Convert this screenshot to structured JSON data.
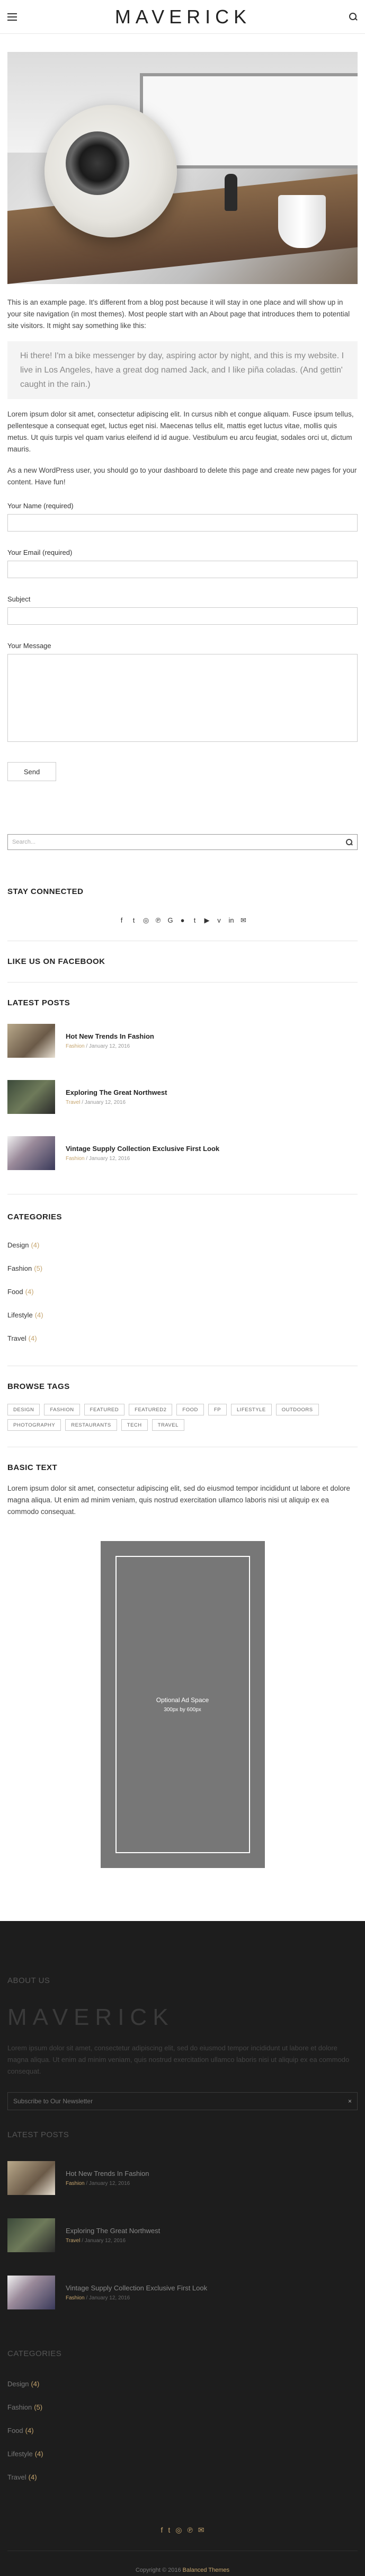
{
  "header": {
    "logo": "MAVERICK",
    "menu_icon": "hamburger-icon",
    "search_icon": "search-icon"
  },
  "hero_image": {
    "alt": ""
  },
  "page": {
    "p1": "This is an example page. It's different from a blog post because it will stay in one place and will show up in your site navigation (in most themes). Most people start with an About page that introduces them to potential site visitors. It might say something like this:",
    "quote": "Hi there! I'm a bike messenger by day, aspiring actor by night, and this is my website. I live in Los Angeles, have a great dog named Jack, and I like piña coladas. (And gettin' caught in the rain.)",
    "p2": "Lorem ipsum dolor sit amet, consectetur adipiscing elit. In cursus nibh et congue aliquam. Fusce ipsum tellus, pellentesque a consequat eget, luctus eget nisi. Maecenas tellus elit, mattis eget luctus vitae, mollis quis metus. Ut quis turpis vel quam varius eleifend id id augue. Vestibulum eu arcu feugiat, sodales orci ut, dictum mauris.",
    "p3": "As a new WordPress user, you should go to your dashboard to delete this page and create new pages for your content. Have fun!"
  },
  "form": {
    "name_label": "Your Name (required)",
    "email_label": "Your Email (required)",
    "subject_label": "Subject",
    "message_label": "Your Message",
    "send_label": "Send"
  },
  "sidebar": {
    "search_placeholder": "Search...",
    "stay_connected": "STAY CONNECTED",
    "social_icons": [
      "facebook-icon",
      "twitter-icon",
      "instagram-icon",
      "pinterest-icon",
      "google-plus-icon",
      "flickr-icon",
      "tumblr-icon",
      "youtube-icon",
      "vimeo-icon",
      "linkedin-icon",
      "email-icon"
    ],
    "facebook_title": "LIKE US ON FACEBOOK",
    "latest_posts_title": "LATEST POSTS",
    "posts": [
      {
        "title": "Hot New Trends In Fashion",
        "category": "Fashion",
        "date": "January 12, 2016"
      },
      {
        "title": "Exploring The Great Northwest",
        "category": "Travel",
        "date": "January 12, 2016"
      },
      {
        "title": "Vintage Supply Collection Exclusive First Look",
        "category": "Fashion",
        "date": "January 12, 2016"
      }
    ],
    "categories_title": "CATEGORIES",
    "categories": [
      {
        "name": "Design",
        "count": "(4)"
      },
      {
        "name": "Fashion",
        "count": "(5)"
      },
      {
        "name": "Food",
        "count": "(4)"
      },
      {
        "name": "Lifestyle",
        "count": "(4)"
      },
      {
        "name": "Travel",
        "count": "(4)"
      }
    ],
    "tags_title": "BROWSE TAGS",
    "tags": [
      "DESIGN",
      "FASHION",
      "FEATURED",
      "FEATURED2",
      "FOOD",
      "FP",
      "LIFESTYLE",
      "OUTDOORS",
      "PHOTOGRAPHY",
      "RESTAURANTS",
      "TECH",
      "TRAVEL"
    ],
    "basic_text_title": "BASIC TEXT",
    "basic_text": "Lorem ipsum dolor sit amet, consectetur adipiscing elit, sed do eiusmod tempor incididunt ut labore et dolore magna aliqua. Ut enim ad minim veniam, quis nostrud exercitation ullamco laboris nisi ut aliquip ex ea commodo consequat.",
    "ad_line1": "Optional Ad Space",
    "ad_line2": "300px by 600px"
  },
  "footer": {
    "about_title": "ABOUT US",
    "logo": "MAVERICK",
    "about_text": "Lorem ipsum dolor sit amet, consectetur adipiscing elit, sed do eiusmod tempor incididunt ut labore et dolore magna aliqua. Ut enim ad minim veniam, quis nostrud exercitation ullamco laboris nisi ut aliquip ex ea commodo consequat.",
    "newsletter_placeholder": "Subscribe to Our Newsletter",
    "newsletter_close": "×",
    "latest_posts_title": "LATEST POSTS",
    "posts": [
      {
        "title": "Hot New Trends In Fashion",
        "category": "Fashion",
        "date": "January 12, 2016"
      },
      {
        "title": "Exploring The Great Northwest",
        "category": "Travel",
        "date": "January 12, 2016"
      },
      {
        "title": "Vintage Supply Collection Exclusive First Look",
        "category": "Fashion",
        "date": "January 12, 2016"
      }
    ],
    "categories_title": "CATEGORIES",
    "categories": [
      {
        "name": "Design",
        "count": "(4)"
      },
      {
        "name": "Fashion",
        "count": "(5)"
      },
      {
        "name": "Food",
        "count": "(4)"
      },
      {
        "name": "Lifestyle",
        "count": "(4)"
      },
      {
        "name": "Travel",
        "count": "(4)"
      }
    ],
    "social_icons": [
      "facebook-icon",
      "twitter-icon",
      "instagram-icon",
      "pinterest-icon",
      "email-icon"
    ],
    "copyright_prefix": "Copyright © 2016",
    "copyright_brand": "Balanced Themes"
  },
  "colors": {
    "accent": "#c5a46d",
    "footer_bg": "#1d1d1d",
    "ad_bg": "#777777"
  }
}
